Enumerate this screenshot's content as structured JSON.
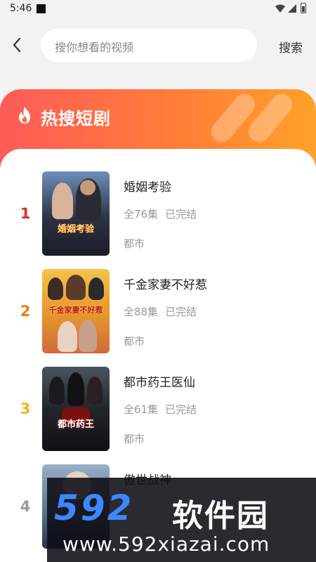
{
  "status_bar": {
    "time": "5:46"
  },
  "search": {
    "placeholder": "搜你想看的视频",
    "button_label": "搜索"
  },
  "section": {
    "title": "热搜短剧"
  },
  "dramas": [
    {
      "rank": "1",
      "rank_color": "#e0302c",
      "title": "婚姻考验",
      "episodes": "全76集",
      "status": "已完结",
      "genre": "都市",
      "poster_text": "婚姻考验"
    },
    {
      "rank": "2",
      "rank_color": "#f07a1a",
      "title": "千金家妻不好惹",
      "episodes": "全88集",
      "status": "已完结",
      "genre": "都市",
      "poster_text": "千金家妻不好惹"
    },
    {
      "rank": "3",
      "rank_color": "#f2b418",
      "title": "都市药王医仙",
      "episodes": "全61集",
      "status": "已完结",
      "genre": "都市",
      "poster_text": "都市药王"
    },
    {
      "rank": "4",
      "rank_color": "#9a9a9a",
      "title": "傲世战神",
      "episodes": "",
      "status": "",
      "genre": "",
      "poster_text": ""
    }
  ],
  "watermark": {
    "logo": "592",
    "name": "软件园",
    "url": "www.592xiazai.com"
  }
}
